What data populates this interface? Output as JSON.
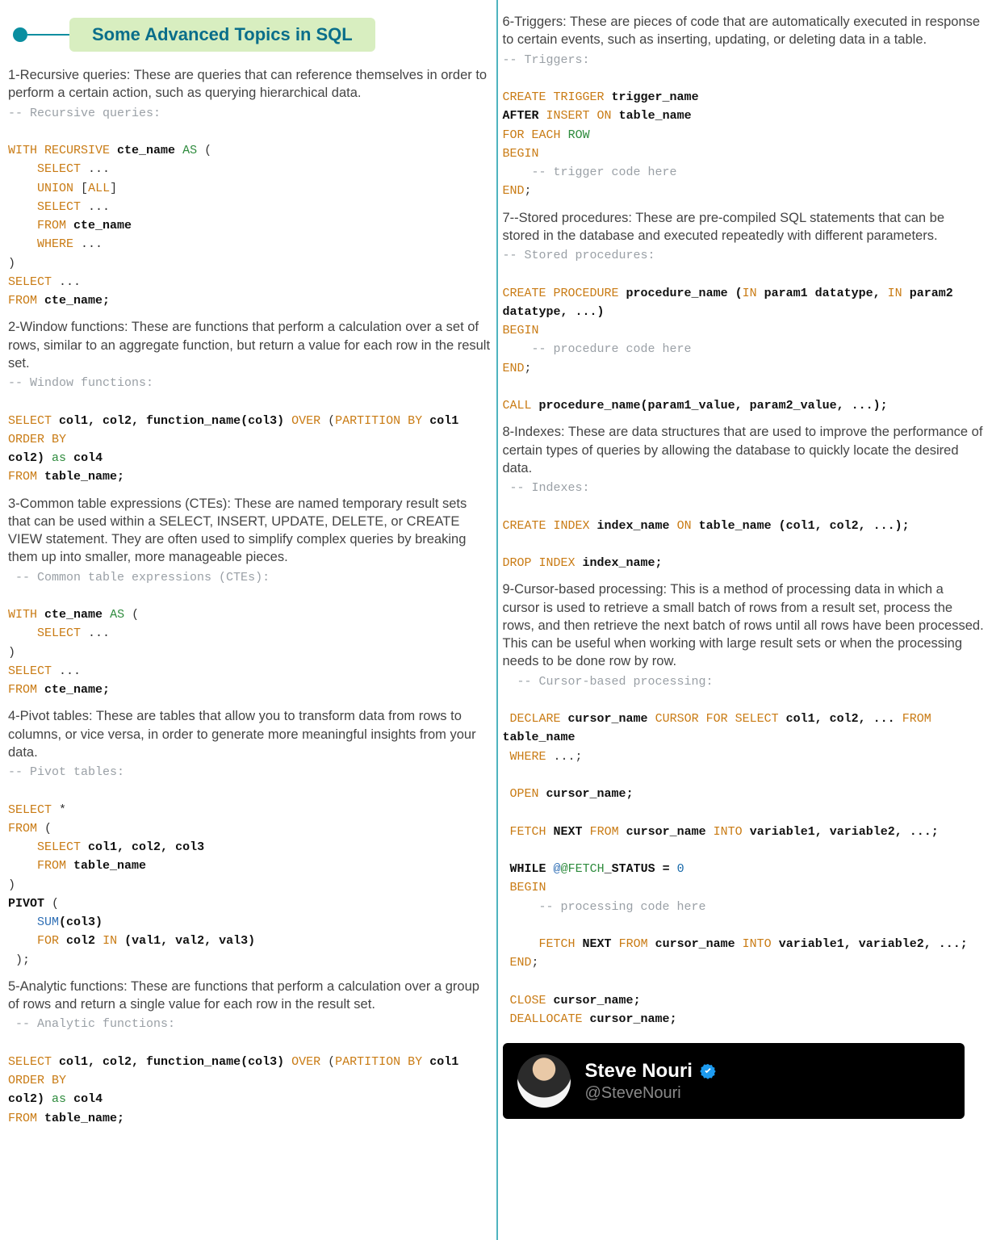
{
  "title": "Some Advanced Topics in SQL",
  "left": {
    "s1_desc": "1-Recursive queries: These are queries that can reference themselves in order to perform a certain action, such as querying hierarchical data.",
    "s1_cmt": "-- Recursive queries:",
    "s1_l1a": "WITH RECURSIVE",
    "s1_l1b": "cte_name",
    "s1_l1c": "AS",
    "s1_l1d": "(",
    "s1_l2a": "SELECT",
    "s1_l2b": "...",
    "s1_l3a": "UNION",
    "s1_l3b": "[",
    "s1_l3c": "ALL",
    "s1_l3d": "]",
    "s1_l4a": "SELECT",
    "s1_l4b": "...",
    "s1_l5a": "FROM",
    "s1_l5b": "cte_name",
    "s1_l6a": "WHERE",
    "s1_l6b": "...",
    "s1_l7": ")",
    "s1_l8a": "SELECT",
    "s1_l8b": "...",
    "s1_l9a": "FROM",
    "s1_l9b": "cte_name;",
    "s2_desc": "2-Window functions: These are functions that perform a calculation over a set of rows, similar to an aggregate function, but return a value for each row in the result set.",
    "s2_cmt": "-- Window functions:",
    "s2_l1a": "SELECT",
    "s2_l1b": "col1, col2, function_name(col3)",
    "s2_l1c": "OVER",
    "s2_l1d": "(",
    "s2_l1e": "PARTITION BY",
    "s2_l1f": "col1",
    "s2_l1g": "ORDER BY",
    "s2_l2a": "col2)",
    "s2_l2b": "as",
    "s2_l2c": "col4",
    "s2_l3a": "FROM",
    "s2_l3b": "table_name;",
    "s3_desc": "3-Common table expressions (CTEs): These are named temporary result sets that can be used within a SELECT, INSERT, UPDATE, DELETE, or CREATE VIEW statement. They are often used to simplify complex queries by breaking them up into smaller, more manageable pieces.",
    "s3_cmt": " -- Common table expressions (CTEs):",
    "s3_l1a": "WITH",
    "s3_l1b": "cte_name",
    "s3_l1c": "AS",
    "s3_l1d": "(",
    "s3_l2a": "SELECT",
    "s3_l2b": "...",
    "s3_l3": ")",
    "s3_l4a": "SELECT",
    "s3_l4b": "...",
    "s3_l5a": "FROM",
    "s3_l5b": "cte_name;",
    "s4_desc": "4-Pivot tables: These are tables that allow you to transform data from rows to columns, or vice versa, in order to generate more meaningful insights from your data.",
    "s4_cmt": "-- Pivot tables:",
    "s4_l1a": "SELECT",
    "s4_l1b": "*",
    "s4_l2a": "FROM",
    "s4_l2b": "(",
    "s4_l3a": "SELECT",
    "s4_l3b": "col1, col2, col3",
    "s4_l4a": "FROM",
    "s4_l4b": "table_name",
    "s4_l5": ")",
    "s4_l6a": "PIVOT",
    "s4_l6b": "(",
    "s4_l7a": "SUM",
    "s4_l7b": "(col3)",
    "s4_l8a": "FOR",
    "s4_l8b": "col2",
    "s4_l8c": "IN",
    "s4_l8d": "(val1, val2, val3)",
    "s4_l9": " );",
    "s5_desc": "5-Analytic functions: These are functions that perform a calculation over a group of rows and return a single value for each row in the result set.",
    "s5_cmt": " -- Analytic functions:",
    "s5_l1a": "SELECT",
    "s5_l1b": "col1, col2, function_name(col3)",
    "s5_l1c": "OVER",
    "s5_l1d": "(",
    "s5_l1e": "PARTITION BY",
    "s5_l1f": "col1",
    "s5_l1g": "ORDER BY",
    "s5_l2a": "col2)",
    "s5_l2b": "as",
    "s5_l2c": "col4",
    "s5_l3a": "FROM",
    "s5_l3b": "table_name;"
  },
  "right": {
    "s6_desc": "6-Triggers: These are pieces of code that are automatically executed in response to certain events, such as inserting, updating, or deleting data in a table.",
    "s6_cmt": "-- Triggers:",
    "s6_l1a": "CREATE TRIGGER",
    "s6_l1b": "trigger_name",
    "s6_l2a": "AFTER",
    "s6_l2b": "INSERT ON",
    "s6_l2c": "table_name",
    "s6_l3a": "FOR",
    "s6_l3b": "EACH",
    "s6_l3c": "ROW",
    "s6_l4": "BEGIN",
    "s6_l5": "    -- trigger code here",
    "s6_l6a": "END",
    "s6_l6b": ";",
    "s7_desc": "7--Stored procedures: These are pre-compiled SQL statements that can be stored in the database and executed repeatedly with different parameters.",
    "s7_cmt": "-- Stored procedures:",
    "s7_l1a": "CREATE PROCEDURE",
    "s7_l1b": "procedure_name (",
    "s7_l1c": "IN",
    "s7_l1d": "param1 datatype,",
    "s7_l1e": "IN",
    "s7_l1f": "param2",
    "s7_l2": "datatype, ...)",
    "s7_l3": "BEGIN",
    "s7_l4": "    -- procedure code here",
    "s7_l5a": "END",
    "s7_l5b": ";",
    "s7_l6a": "CALL",
    "s7_l6b": "procedure_name(param1_value, param2_value, ...);",
    "s8_desc": "8-Indexes: These are data structures that are used to improve the performance of certain types of queries by allowing the database to quickly locate the desired data.",
    "s8_cmt": " -- Indexes:",
    "s8_l1a": "CREATE INDEX",
    "s8_l1b": "index_name",
    "s8_l1c": "ON",
    "s8_l1d": "table_name (col1, col2, ...);",
    "s8_l2a": "DROP INDEX",
    "s8_l2b": "index_name;",
    "s9_desc": "9-Cursor-based processing: This is a method of processing data in which a cursor is used to retrieve a small batch of rows from a result set, process the rows, and then retrieve the next batch of rows until all rows have been processed. This can be useful when working with large result sets or when the processing needs to be done row by row.",
    "s9_cmt": "  -- Cursor-based processing:",
    "s9_l1a": "DECLARE",
    "s9_l1b": "cursor_name",
    "s9_l1c": "CURSOR FOR SELECT",
    "s9_l1d": "col1, col2, ...",
    "s9_l1e": "FROM",
    "s9_l1f": "table_name",
    "s9_l2a": "WHERE",
    "s9_l2b": "...;",
    "s9_l3a": "OPEN",
    "s9_l3b": "cursor_name;",
    "s9_l4a": "FETCH",
    "s9_l4b": "NEXT",
    "s9_l4c": "FROM",
    "s9_l4d": "cursor_name",
    "s9_l4e": "INTO",
    "s9_l4f": "variable1, variable2, ...;",
    "s9_l5a": "WHILE",
    "s9_l5b": "@",
    "s9_l5c": "@FETCH",
    "s9_l5d": "_STATUS =",
    "s9_l5e": "0",
    "s9_l6": "BEGIN",
    "s9_l7": "    -- processing code here",
    "s9_l8a": "FETCH",
    "s9_l8b": "NEXT",
    "s9_l8c": "FROM",
    "s9_l8d": "cursor_name",
    "s9_l8e": "INTO",
    "s9_l8f": "variable1, variable2, ...;",
    "s9_l9a": "END",
    "s9_l9b": ";",
    "s9_l10a": "CLOSE",
    "s9_l10b": "cursor_name;",
    "s9_l11a": "DEALLOCATE",
    "s9_l11b": "cursor_name;"
  },
  "footer": {
    "name": "Steve Nouri",
    "handle": "@SteveNouri"
  }
}
